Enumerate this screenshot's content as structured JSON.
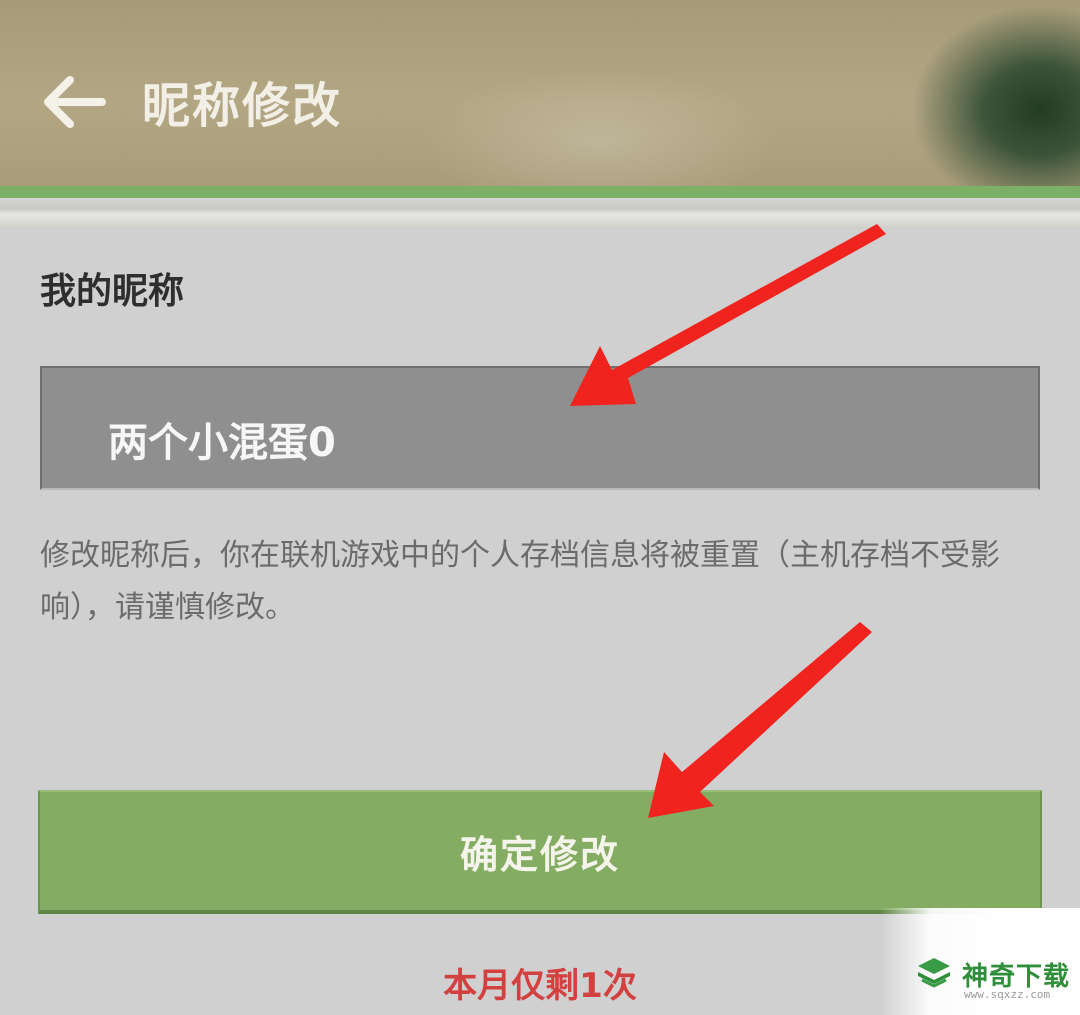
{
  "header": {
    "title": "昵称修改",
    "back_icon": "arrow-left-icon"
  },
  "nickname_section": {
    "label": "我的昵称",
    "current_value": "两个小混蛋0"
  },
  "notice": "修改昵称后，你在联机游戏中的个人存档信息将被重置（主机存档不受影响），请谨慎修改。",
  "confirm_button": {
    "label": "确定修改"
  },
  "remaining_changes": "本月仅剩1次",
  "watermark": {
    "name": "神奇下载",
    "url": "www.sqxzz.com"
  },
  "colors": {
    "accent_green": "#84ac63",
    "warning_red": "#d2413f",
    "annotation_arrow": "#f0231e"
  }
}
